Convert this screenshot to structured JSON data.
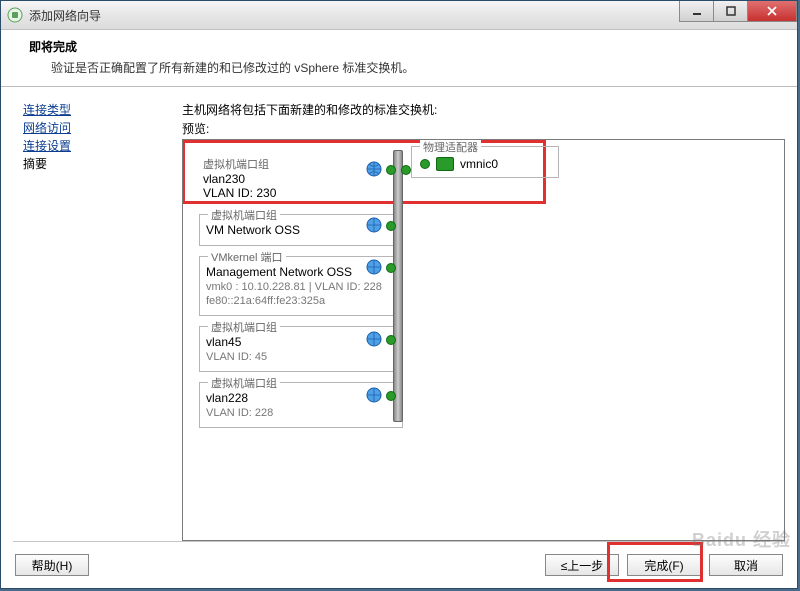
{
  "window": {
    "title": "添加网络向导"
  },
  "header": {
    "title": "即将完成",
    "desc": "验证是否正确配置了所有新建的和已修改过的 vSphere 标准交换机。"
  },
  "sidebar": {
    "items": [
      {
        "label": "连接类型",
        "link": true
      },
      {
        "label": "网络访问",
        "link": true
      },
      {
        "label": "连接设置",
        "link": true
      },
      {
        "label": "摘要",
        "link": false
      }
    ]
  },
  "main": {
    "desc": "主机网络将包括下面新建的和修改的标准交换机:",
    "preview_label": "预览:",
    "physical": {
      "legend": "物理适配器",
      "nic": "vmnic0"
    },
    "portgroups": [
      {
        "legend": "虚拟机端口组",
        "name": "vlan230",
        "lines": [
          "VLAN ID: 230"
        ],
        "highlight": true
      },
      {
        "legend": "虚拟机端口组",
        "name": "VM Network OSS",
        "lines": []
      },
      {
        "legend": "VMkernel 端口",
        "name": "Management Network OSS",
        "lines": [
          "vmk0 : 10.10.228.81 | VLAN ID: 228",
          "fe80::21a:64ff:fe23:325a"
        ]
      },
      {
        "legend": "虚拟机端口组",
        "name": "vlan45",
        "lines": [
          "VLAN ID: 45"
        ]
      },
      {
        "legend": "虚拟机端口组",
        "name": "vlan228",
        "lines": [
          "VLAN ID: 228"
        ]
      }
    ]
  },
  "footer": {
    "help": "帮助(H)",
    "back": "≤上一步",
    "finish": "完成(F)",
    "cancel": "取消"
  },
  "watermark": "Baidu 经验"
}
